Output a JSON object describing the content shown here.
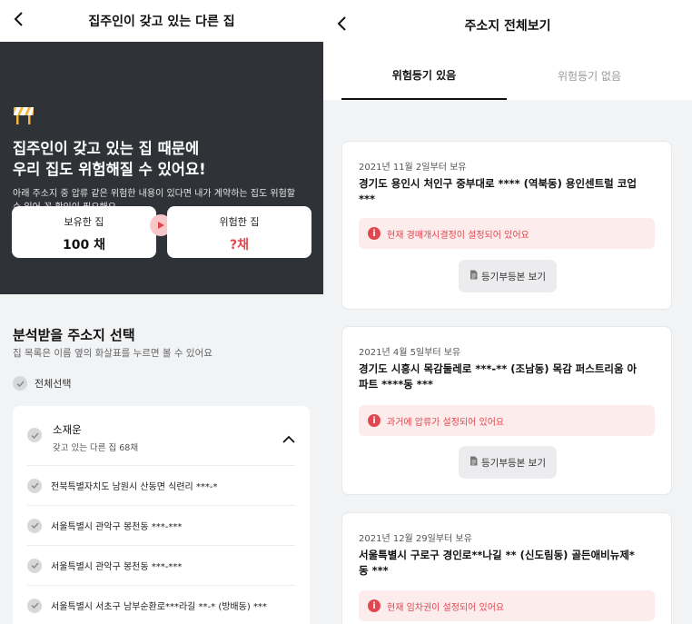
{
  "left": {
    "header_title": "집주인이 갖고 있는 다른 집",
    "headline_line1": "집주인이 갖고 있는 집 때문에",
    "headline_line2": "우리 집도 위험해질 수 있어요!",
    "subtext_line1": "아래 주소지 중 압류 같은 위험한 내용이 있다면 내가 계약하는 집도 위험할",
    "subtext_line2": "수 있어 꼭 확인이 필요해요",
    "owned": {
      "label": "보유한 집",
      "value": "100 채"
    },
    "risky": {
      "label": "위험한 집",
      "value": "?채"
    },
    "select_title": "분석받을 주소지 선택",
    "select_sub": "집 목록은 이름 옆의 화살표를 누르면 볼 수 있어요",
    "select_all": "전체선택",
    "owner": {
      "name": "소재운",
      "count": "갖고 있는 다른 집 68채"
    },
    "addresses": [
      "전북특별자치도 남원시 산동면 식련리 ***-*",
      "서울특별시 관악구 봉천동 ***-***",
      "서울특별시 관악구 봉천동 ***-***",
      "서울특별시 서초구 남부순환로***라길 **-* (방배동) ***"
    ]
  },
  "right": {
    "header_title": "주소지 전체보기",
    "tab_active": "위험등기 있음",
    "tab_inactive": "위험등기 없음",
    "view_label": "등기부등본 보기",
    "cards": [
      {
        "since": "2021년 11월 2일부터 보유",
        "addr_line1": "경기도 용인시 처인구 중부대로 **** (역북동) 용인센트럴 코업",
        "addr_line2": "***",
        "alert": "현재 경매개시결정이 설정되어 있어요"
      },
      {
        "since": "2021년 4월 5일부터 보유",
        "addr_line1": "경기도 시흥시 목감둘레로 ***-** (조남동) 목감 퍼스트리움 아",
        "addr_line2": "파트 ****동 ***",
        "alert": "과거에 압류가 설정되어 있어요"
      },
      {
        "since": "2021년 12월 29일부터 보유",
        "addr_line1": "서울특별시 구로구 경인로**나길 ** (신도림동) 골든애비뉴제*",
        "addr_line2": "동 ***",
        "alert": "현재 임차권이 설정되어 있어요"
      }
    ]
  },
  "colors": {
    "dark_bg": "#2f3337",
    "danger": "#e2474f",
    "danger_bg": "#fdecec"
  },
  "icons": [
    "back-arrow-icon",
    "barricade-icon",
    "play-arrow-icon",
    "check-icon",
    "chevron-up-icon",
    "info-icon",
    "document-icon"
  ]
}
